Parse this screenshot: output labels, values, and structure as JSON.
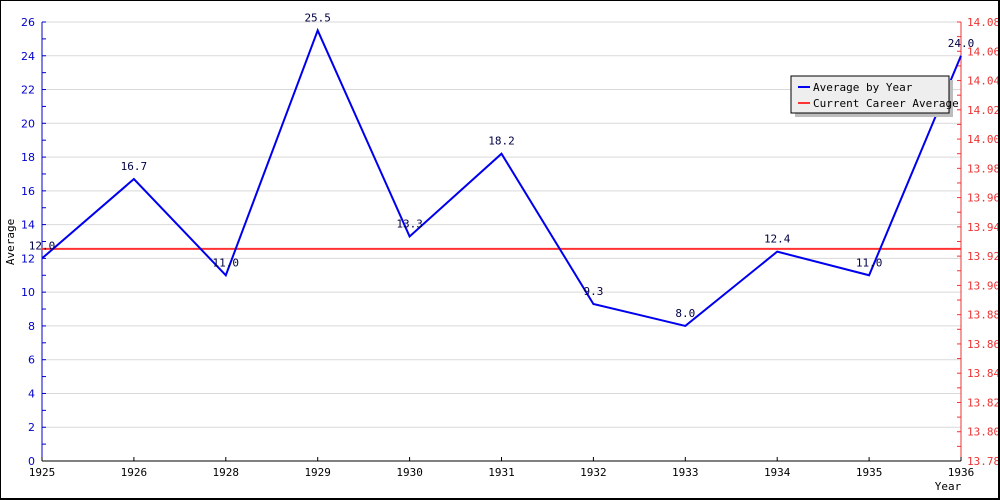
{
  "chart_data": {
    "type": "line",
    "title": "",
    "xlabel": "Year",
    "ylabel": "Average",
    "categories": [
      "1925",
      "1926",
      "1928",
      "1929",
      "1930",
      "1931",
      "1932",
      "1933",
      "1934",
      "1935",
      "1936"
    ],
    "series": [
      {
        "name": "Average by Year",
        "axis": "left",
        "color": "#0000ee",
        "values": [
          12.0,
          16.7,
          11.0,
          25.5,
          13.3,
          18.2,
          9.3,
          8.0,
          12.4,
          11.0,
          24.0
        ],
        "labels": [
          "12.0",
          "16.7",
          "11.0",
          "25.5",
          "13.3",
          "18.2",
          "9.3",
          "8.0",
          "12.4",
          "11.0",
          "24.0"
        ]
      },
      {
        "name": "Current Career Average",
        "axis": "right",
        "color": "#ff3333",
        "value": 13.925
      }
    ],
    "y_left": {
      "range": [
        0,
        26
      ],
      "ticks": [
        "0",
        "2",
        "4",
        "6",
        "8",
        "10",
        "12",
        "14",
        "16",
        "18",
        "20",
        "22",
        "24",
        "26"
      ],
      "color": "#0000cc"
    },
    "y_right": {
      "range": [
        13.78,
        14.08
      ],
      "ticks": [
        "13.78",
        "13.80",
        "13.82",
        "13.84",
        "13.86",
        "13.88",
        "13.90",
        "13.92",
        "13.94",
        "13.96",
        "13.98",
        "14.00",
        "14.02",
        "14.04",
        "14.06",
        "14.08"
      ],
      "color": "#ee3333"
    },
    "grid": true,
    "legend": {
      "position": "top-right",
      "entries": [
        "Average by Year",
        "Current Career Average"
      ]
    }
  }
}
